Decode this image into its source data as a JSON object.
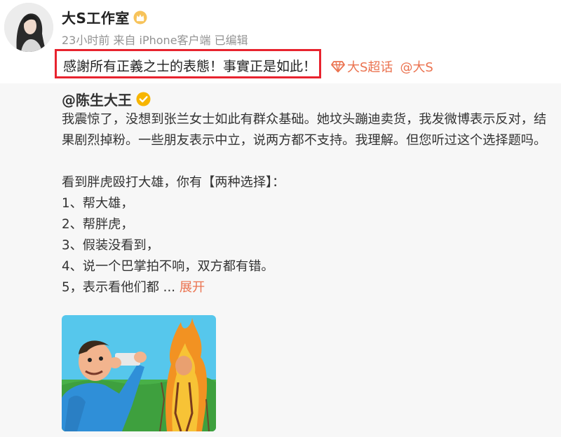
{
  "post": {
    "author": "大S工作室",
    "meta": "23小时前 来自 iPhone客户端 已编辑",
    "text": "感謝所有正義之士的表態！事實正是如此！",
    "topic": "大S超话",
    "mention": "@大S"
  },
  "repost": {
    "author": "@陈生大王",
    "lines": [
      "我震惊了，没想到张兰女士如此有群众基础。她坟头蹦迪卖货，我发微博表示反对，结",
      "果剧烈掉粉。一些朋友表示中立，说两方都不支持。我理解。但您听过这个选择题吗。",
      "",
      "看到胖虎殴打大雄，你有【两种选择】：",
      "1、帮大雄，",
      "2、帮胖虎，",
      "3、假装没看到，",
      "4、说一个巴掌拍不响，双方都有错。"
    ],
    "last_line": "5，表示看他们都 ...",
    "expand_label": "展开"
  },
  "colors": {
    "accent": "#eb7350",
    "highlight_box": "#e8232e",
    "meta_text": "#939393",
    "repost_bg": "#f7f7f7"
  },
  "icons": [
    "crown-icon",
    "super-topic-diamond-icon",
    "verified-badge-icon"
  ]
}
